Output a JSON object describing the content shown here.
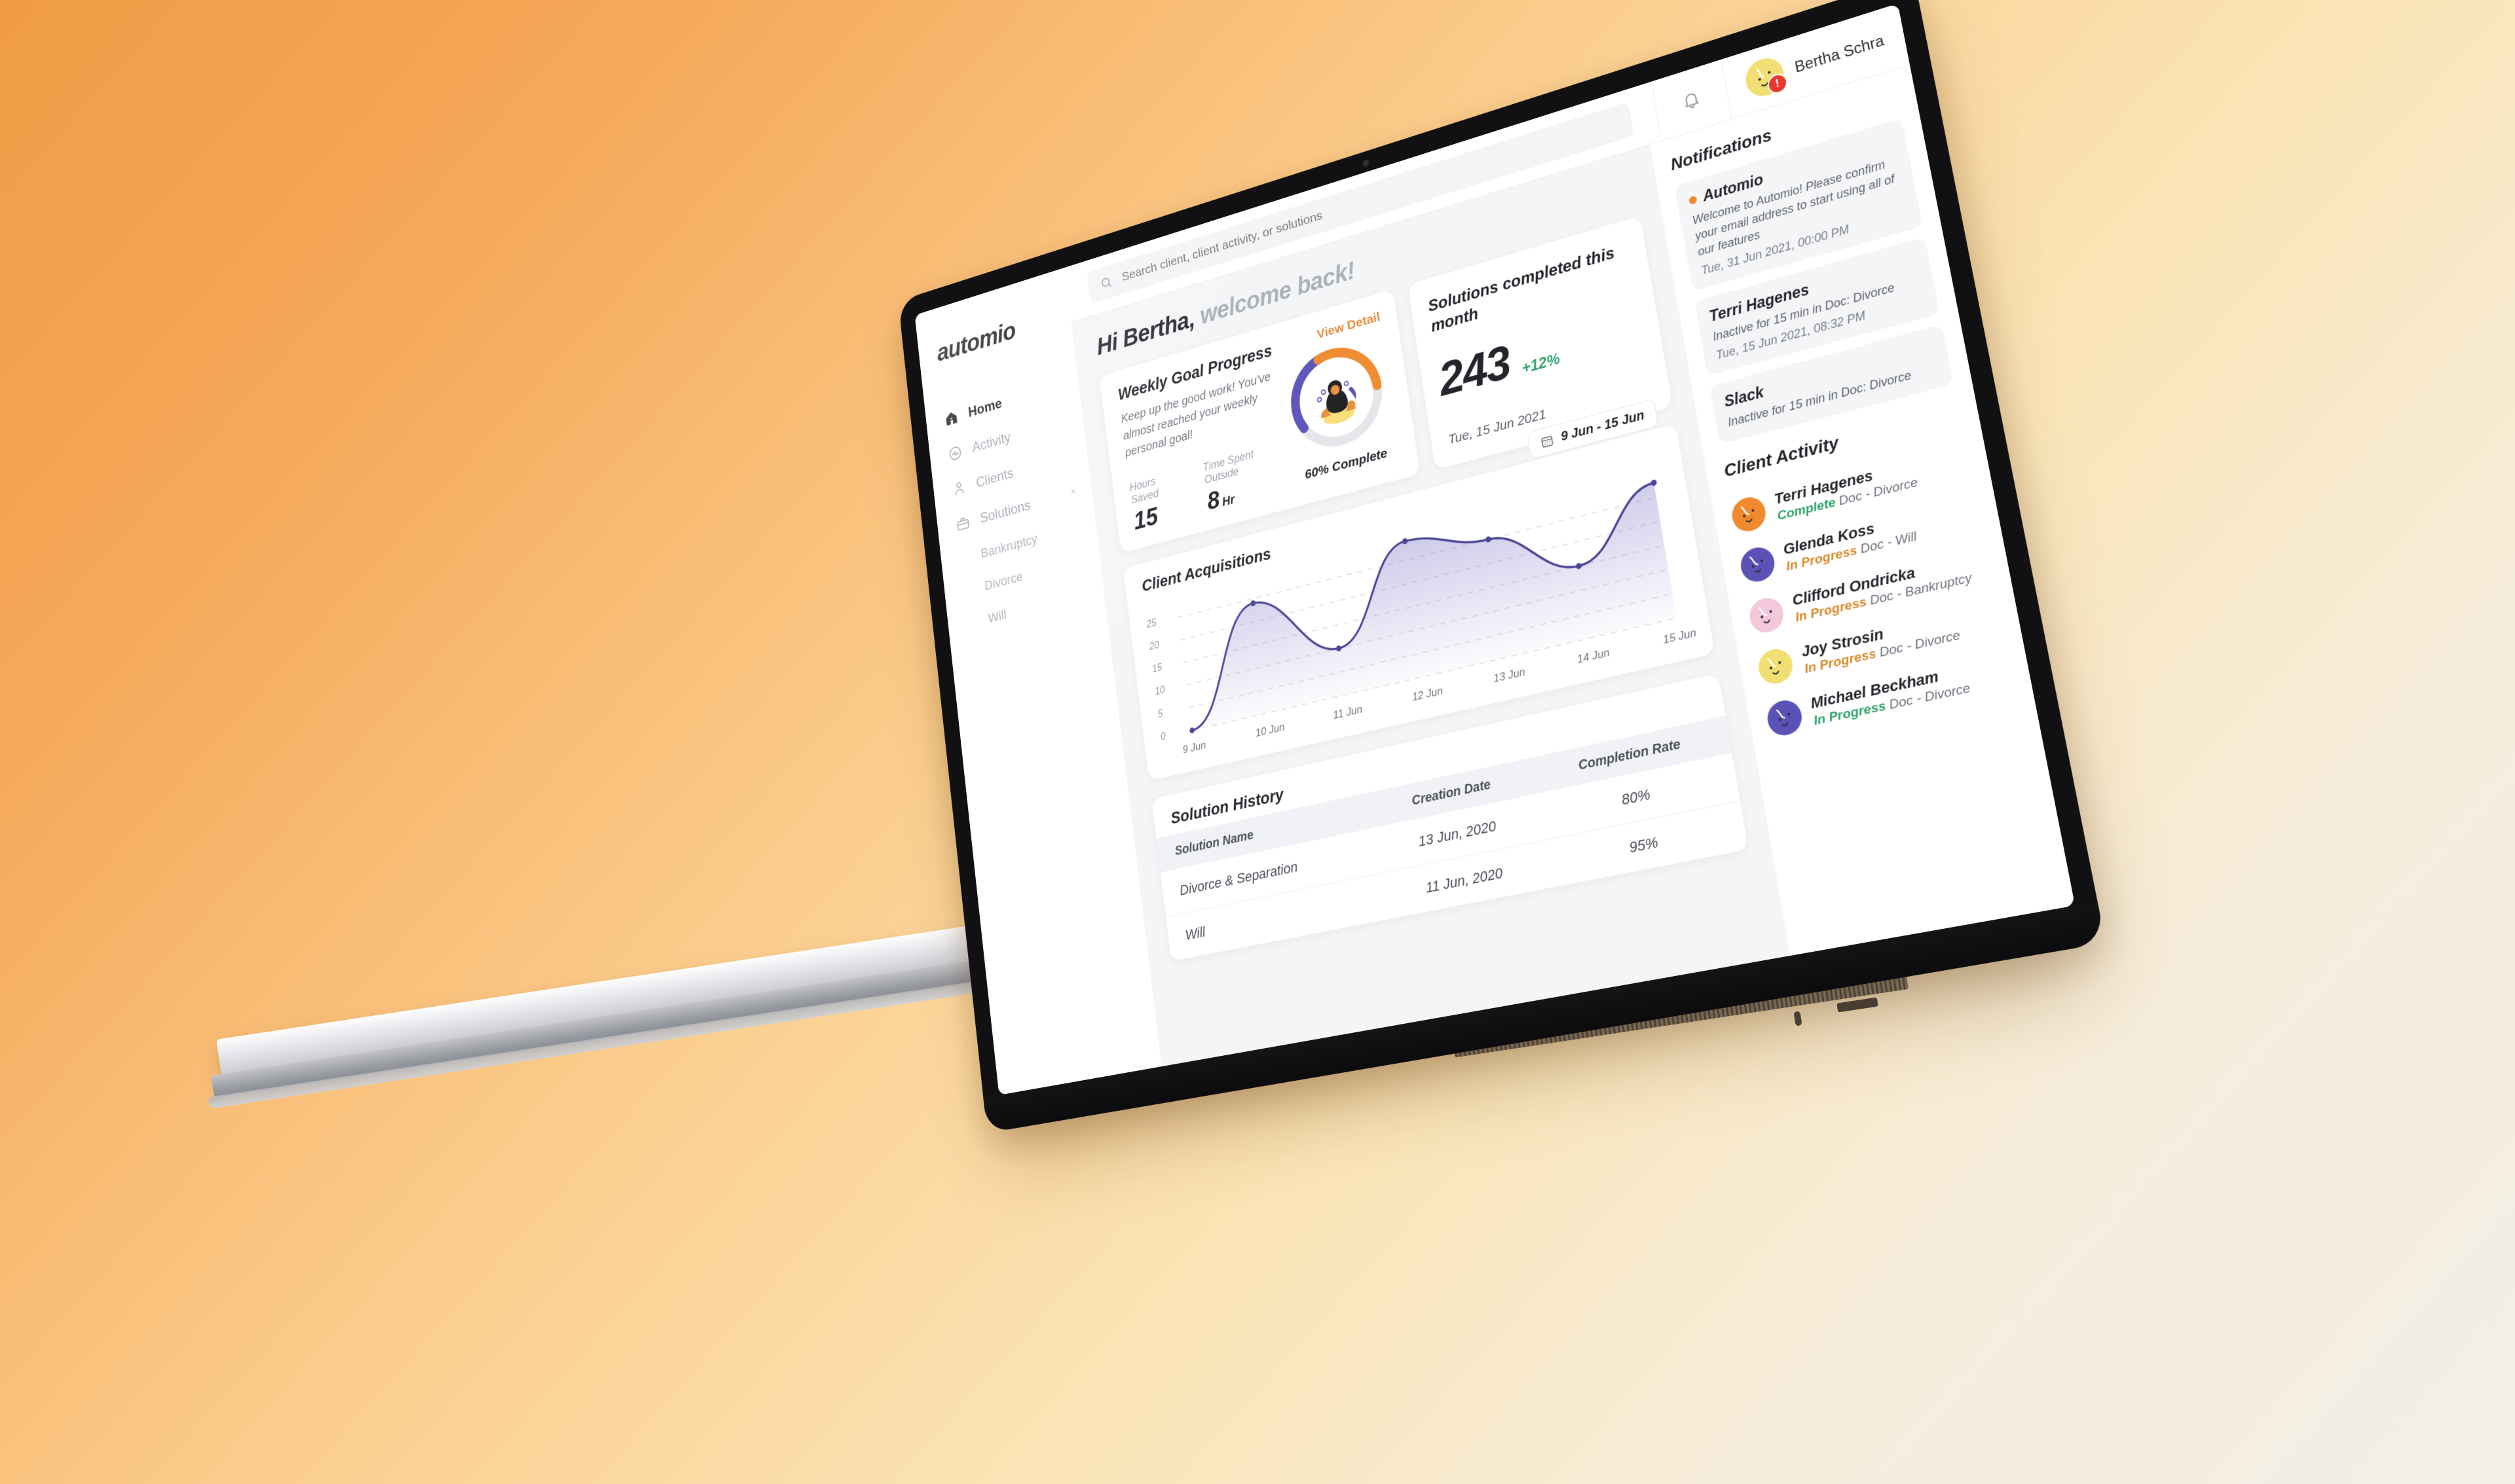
{
  "brand": {
    "logo": "automio",
    "accent_orange": "#E8893C",
    "accent_purple": "#4A4494",
    "accent_green": "#2FA36B"
  },
  "sidebar": {
    "items": [
      {
        "label": "Home",
        "icon": "home-icon",
        "active": true
      },
      {
        "label": "Activity",
        "icon": "activity-icon",
        "active": false
      },
      {
        "label": "Clients",
        "icon": "clients-icon",
        "active": false
      },
      {
        "label": "Solutions",
        "icon": "briefcase-icon",
        "active": false,
        "expanded": true
      }
    ],
    "sub_items": [
      "Bankruptcy",
      "Divorce",
      "Will"
    ]
  },
  "topbar": {
    "search_placeholder": "Search client, client activity, or solutions",
    "search_value": "",
    "search_icon": "search-icon",
    "bell_icon": "bell-icon",
    "user_name": "Bertha Schra",
    "avatar_badge": "!"
  },
  "greeting": {
    "bold": "Hi Bertha,",
    "soft": "welcome back!"
  },
  "goal_card": {
    "title": "Weekly Goal Progress",
    "view_detail": "View Detail",
    "description": "Keep up the good work! You've almost reached your weekly personal goal!",
    "stats": [
      {
        "label": "Hours Saved",
        "value": "15",
        "unit": ""
      },
      {
        "label": "Time Spent Outside",
        "value": "8",
        "unit": "Hr"
      }
    ],
    "ring_caption": "60% Complete",
    "ring_percent": 60,
    "ring_orange": "#F08A2E",
    "ring_purple": "#5B52B8",
    "ring_track": "#E5E6EA"
  },
  "solutions_card": {
    "title": "Solutions completed this month",
    "value": "243",
    "delta": "+12%",
    "date": "Tue, 15 Jun 2021"
  },
  "date_range": {
    "label": "9 Jun - 15 Jun",
    "icon": "calendar-icon"
  },
  "chart_data": {
    "type": "line",
    "title": "Client Acquisitions",
    "categories": [
      "9 Jun",
      "10 Jun",
      "11 Jun",
      "12 Jun",
      "13 Jun",
      "14 Jun",
      "15 Jun"
    ],
    "values": [
      0,
      24,
      10,
      29,
      25,
      15,
      28
    ],
    "xlabel": "",
    "ylabel": "",
    "yticks": [
      0,
      5,
      10,
      15,
      20,
      25
    ],
    "ylim": [
      0,
      30
    ],
    "grid": true,
    "grid_style": "dashed-horizontal",
    "line_color": "#4A4494",
    "fill": "gradient-purple",
    "legend": "none"
  },
  "history": {
    "title": "Solution History",
    "columns": [
      "Solution Name",
      "Creation Date",
      "Completion Rate"
    ],
    "rows": [
      {
        "name": "Divorce & Separation",
        "date": "13 Jun, 2020",
        "rate": "80%"
      },
      {
        "name": "Will",
        "date": "11 Jun, 2020",
        "rate": "95%"
      }
    ]
  },
  "notifications": {
    "title": "Notifications",
    "items": [
      {
        "name": "Automio",
        "has_dot": true,
        "dot_color": "#F08A2E",
        "text": "Welcome to Automio! Please confirm your email address to start using all of our features",
        "time": "Tue, 31 Jun 2021, 00:00 PM"
      },
      {
        "name": "Terri Hagenes",
        "has_dot": false,
        "dot_color": "",
        "text": "Inactive for 15 min in Doc: Divorce",
        "time": "Tue, 15 Jun 2021, 08:32 PM"
      },
      {
        "name": "Slack",
        "has_dot": false,
        "dot_color": "",
        "text": "Inactive for 15 min in Doc: Divorce",
        "time": ""
      }
    ]
  },
  "client_activity": {
    "title": "Client Activity",
    "items": [
      {
        "name": "Terri Hagenes",
        "status": "Complete",
        "status_color": "#2FA36B",
        "doc": "Doc - Divorce",
        "avatar_color": "#F08A2E"
      },
      {
        "name": "Glenda Koss",
        "status": "In Progress",
        "status_color": "#D98A2B",
        "doc": "Doc - Will",
        "avatar_color": "#5B52B8"
      },
      {
        "name": "Clifford Ondricka",
        "status": "In Progress",
        "status_color": "#D98A2B",
        "doc": "Doc - Bankruptcy",
        "avatar_color": "#F3C8DA"
      },
      {
        "name": "Joy Strosin",
        "status": "In Progress",
        "status_color": "#D98A2B",
        "doc": "Doc - Divorce",
        "avatar_color": "#F2DF74"
      },
      {
        "name": "Michael Beckham",
        "status": "In Progress",
        "status_color": "#2FA36B",
        "doc": "Doc - Divorce",
        "avatar_color": "#5B52B8"
      }
    ]
  }
}
